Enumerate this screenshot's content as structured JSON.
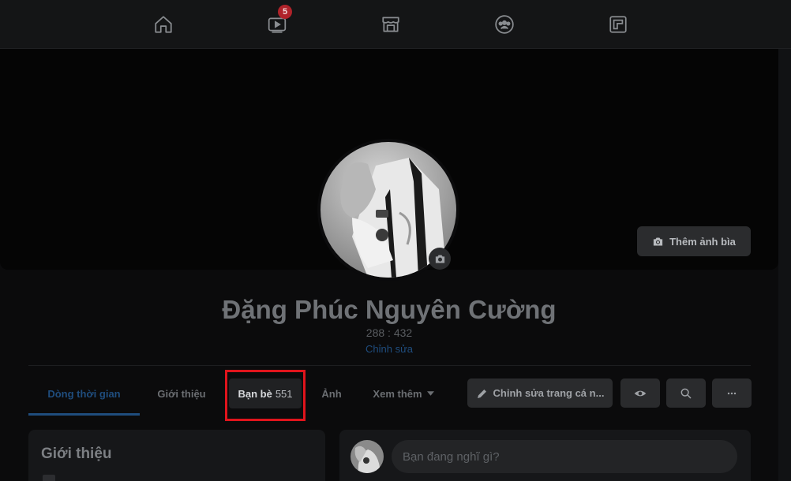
{
  "topnav": {
    "items": [
      {
        "name": "home-icon"
      },
      {
        "name": "watch-icon",
        "badge": "5"
      },
      {
        "name": "marketplace-icon"
      },
      {
        "name": "groups-icon"
      },
      {
        "name": "gaming-icon"
      }
    ],
    "badge_color": "#b0232a"
  },
  "cover": {
    "add_cover_label": "Thêm ảnh bìa"
  },
  "profile": {
    "name": "Đặng Phúc Nguyên Cường",
    "stat": "288 : 432",
    "edit_bio": "Chỉnh sửa"
  },
  "tabs": {
    "timeline": "Dòng thời gian",
    "about": "Giới thiệu",
    "friends": "Bạn bè",
    "friends_count": "551",
    "photos": "Ảnh",
    "more": "Xem thêm"
  },
  "actions": {
    "edit_profile": "Chỉnh sửa trang cá n..."
  },
  "intro": {
    "title": "Giới thiệu"
  },
  "composer": {
    "placeholder": "Bạn đang nghĩ gì?"
  },
  "colors": {
    "accent": "#1f4d7e",
    "highlight": "#e0141c"
  }
}
